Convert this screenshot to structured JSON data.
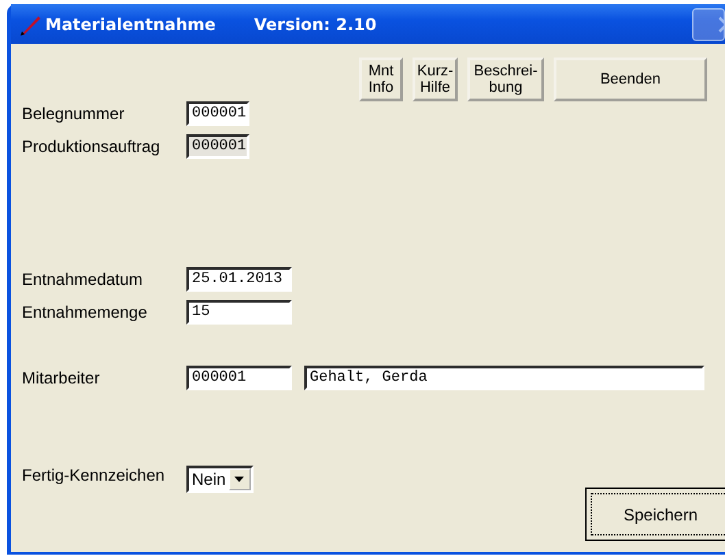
{
  "window": {
    "title": "Materialentnahme",
    "version": "Version: 2.10"
  },
  "toolbar": [
    {
      "label": "Mnt\nInfo"
    },
    {
      "label": "Kurz-\nHilfe"
    },
    {
      "label": "Beschrei-\nbung"
    },
    {
      "label": "Beenden"
    }
  ],
  "sections": [
    {
      "fields": [
        {
          "kind": "text",
          "label": "Belegnummer",
          "values": [
            "000001"
          ],
          "disabled": false
        },
        {
          "kind": "text",
          "label": "Produktionsauftrag",
          "values": [
            "000001"
          ],
          "disabled": true
        }
      ]
    },
    {
      "fields": [
        {
          "kind": "text",
          "label": "Entnahmedatum",
          "values": [
            "25.01.2013"
          ],
          "disabled": false
        },
        {
          "kind": "text",
          "label": "Entnahmemenge",
          "values": [
            "15"
          ],
          "disabled": false
        }
      ]
    },
    {
      "fields": [
        {
          "kind": "text",
          "label": "Mitarbeiter",
          "values": [
            "000001",
            "Gehalt, Gerda"
          ],
          "disabled": false
        }
      ]
    },
    {
      "fields": [
        {
          "kind": "dropdown",
          "label": "Fertig-Kennzeichen",
          "values": [
            "Nein"
          ],
          "disabled": false
        }
      ]
    }
  ],
  "save_button": {
    "label": "Speichern"
  }
}
